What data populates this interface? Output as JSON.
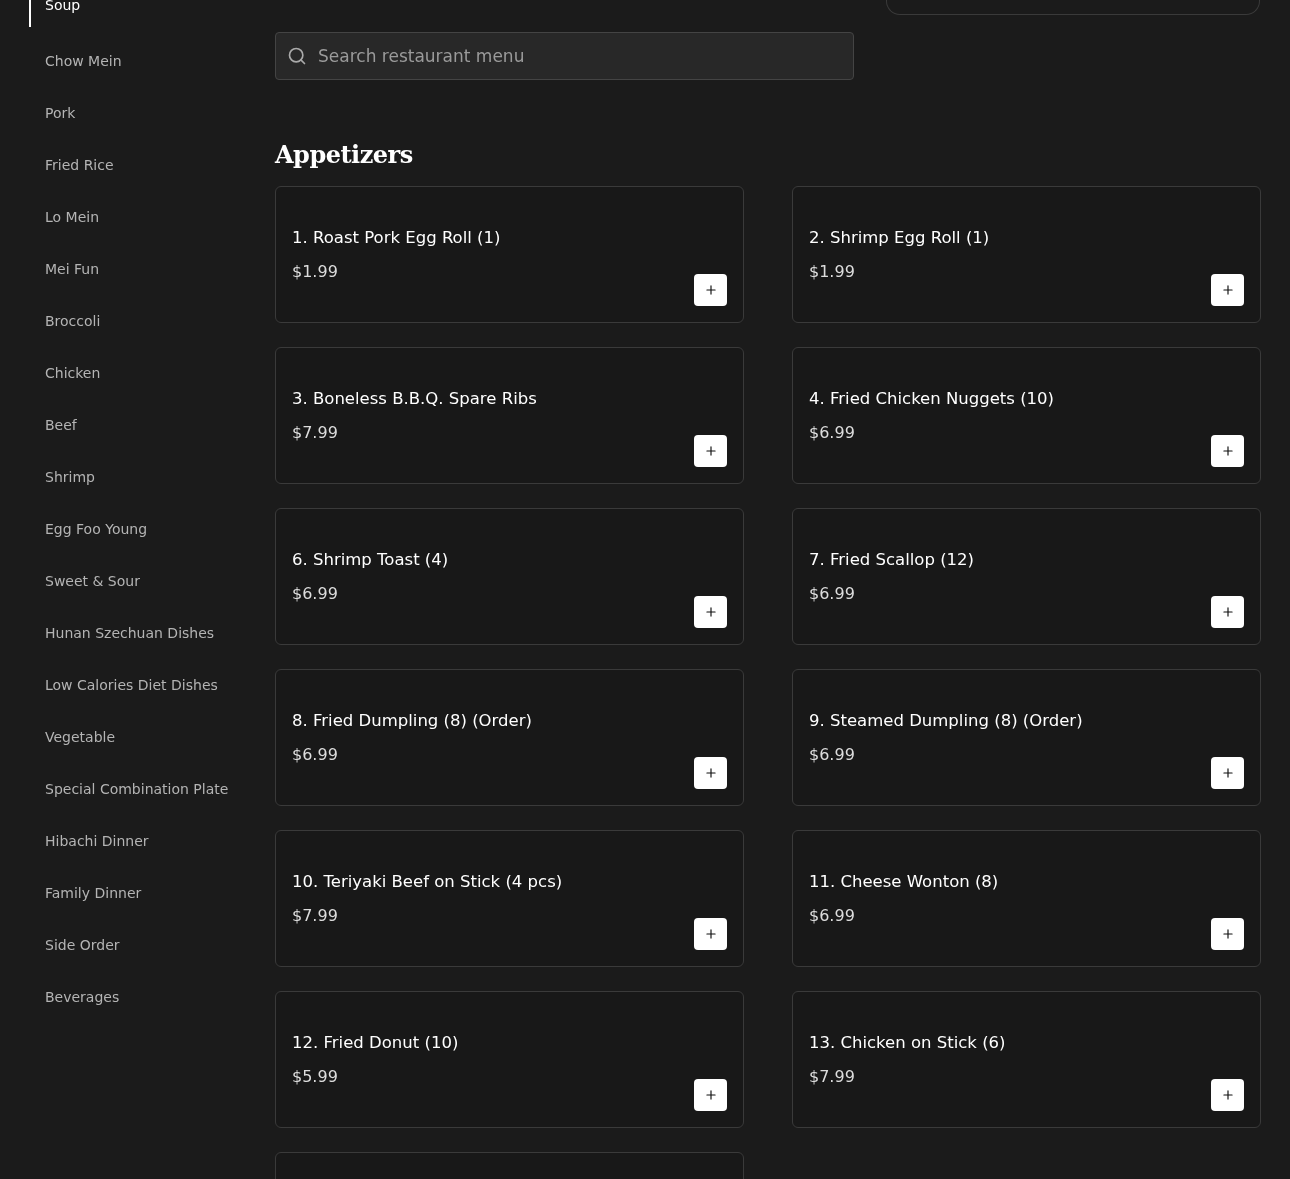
{
  "sidebar": {
    "items": [
      {
        "label": "Soup",
        "selected": true
      },
      {
        "label": "Chow Mein",
        "selected": false
      },
      {
        "label": "Pork",
        "selected": false
      },
      {
        "label": "Fried Rice",
        "selected": false
      },
      {
        "label": "Lo Mein",
        "selected": false
      },
      {
        "label": "Mei Fun",
        "selected": false
      },
      {
        "label": "Broccoli",
        "selected": false
      },
      {
        "label": "Chicken",
        "selected": false
      },
      {
        "label": "Beef",
        "selected": false
      },
      {
        "label": "Shrimp",
        "selected": false
      },
      {
        "label": "Egg Foo Young",
        "selected": false
      },
      {
        "label": "Sweet & Sour",
        "selected": false
      },
      {
        "label": "Hunan Szechuan Dishes",
        "selected": false
      },
      {
        "label": "Low Calories Diet Dishes",
        "selected": false
      },
      {
        "label": "Vegetable",
        "selected": false
      },
      {
        "label": "Special Combination Plate",
        "selected": false
      },
      {
        "label": "Hibachi Dinner",
        "selected": false
      },
      {
        "label": "Family Dinner",
        "selected": false
      },
      {
        "label": "Side Order",
        "selected": false
      },
      {
        "label": "Beverages",
        "selected": false
      }
    ]
  },
  "search": {
    "placeholder": "Search restaurant menu"
  },
  "section": {
    "title": "Appetizers",
    "items": [
      {
        "name": "1. Roast Pork Egg Roll (1)",
        "price": "$1.99"
      },
      {
        "name": "2. Shrimp Egg Roll (1)",
        "price": "$1.99"
      },
      {
        "name": "3. Boneless B.B.Q. Spare Ribs",
        "price": "$7.99"
      },
      {
        "name": "4. Fried Chicken Nuggets (10)",
        "price": "$6.99"
      },
      {
        "name": "6. Shrimp Toast (4)",
        "price": "$6.99"
      },
      {
        "name": "7. Fried Scallop (12)",
        "price": "$6.99"
      },
      {
        "name": "8. Fried Dumpling (8) (Order)",
        "price": "$6.99"
      },
      {
        "name": "9. Steamed Dumpling (8) (Order)",
        "price": "$6.99"
      },
      {
        "name": "10. Teriyaki Beef on Stick (4 pcs)",
        "price": "$7.99"
      },
      {
        "name": "11. Cheese Wonton (8)",
        "price": "$6.99"
      },
      {
        "name": "12. Fried Donut (10)",
        "price": "$5.99"
      },
      {
        "name": "13. Chicken on Stick (6)",
        "price": "$7.99"
      }
    ]
  }
}
